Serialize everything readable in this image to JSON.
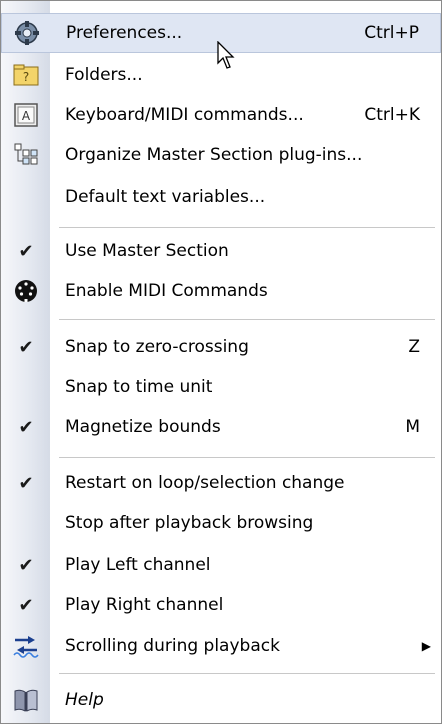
{
  "menu": {
    "items": [
      {
        "label": "Preferences...",
        "shortcut": "Ctrl+P",
        "icon": "preferences-icon"
      },
      {
        "label": "Folders...",
        "icon": "folders-icon"
      },
      {
        "label": "Keyboard/MIDI commands...",
        "shortcut": "Ctrl+K",
        "icon": "keyboard-icon"
      },
      {
        "label": "Organize Master Section plug-ins...",
        "icon": "organize-icon"
      },
      {
        "label": "Default text variables..."
      },
      {
        "label": "Use Master Section",
        "checked": true
      },
      {
        "label": "Enable MIDI Commands",
        "icon": "midi-icon"
      },
      {
        "label": "Snap to zero-crossing",
        "shortcut": "Z",
        "checked": true
      },
      {
        "label": "Snap to time unit"
      },
      {
        "label": "Magnetize bounds",
        "shortcut": "M",
        "checked": true
      },
      {
        "label": "Restart on loop/selection change",
        "checked": true
      },
      {
        "label": "Stop after playback browsing"
      },
      {
        "label": "Play Left channel",
        "checked": true
      },
      {
        "label": "Play Right channel",
        "checked": true
      },
      {
        "label": "Scrolling during playback",
        "icon": "scrolling-icon",
        "submenu": true
      },
      {
        "label": "Help",
        "icon": "help-icon"
      }
    ]
  }
}
